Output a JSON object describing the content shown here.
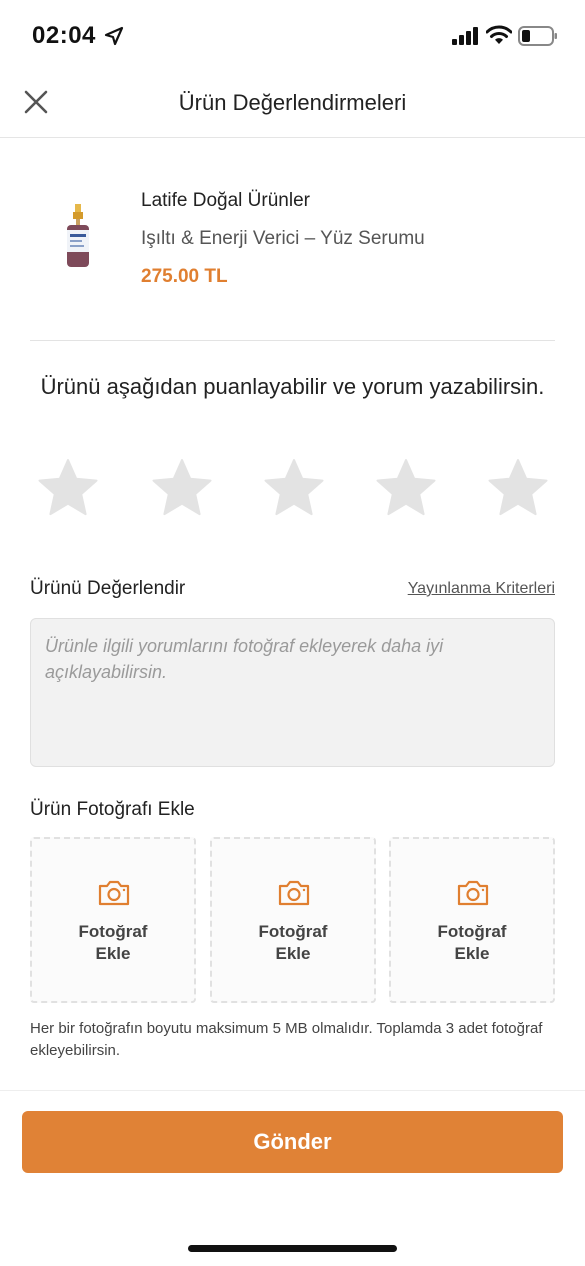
{
  "status_bar": {
    "time": "02:04",
    "icons": [
      "location-arrow-icon",
      "signal-icon",
      "wifi-icon",
      "battery-icon"
    ]
  },
  "header": {
    "title": "Ürün Değerlendirmeleri",
    "close_icon": "close-icon"
  },
  "product": {
    "brand": "Latife Doğal Ürünler",
    "name": "Işıltı & Enerji Verici – Yüz Serumu",
    "price": "275.00 TL",
    "image_icon": "serum-bottle-image"
  },
  "rating": {
    "prompt": "Ürünü aşağıdan puanlayabilir ve yorum yazabilirsin.",
    "max_stars": 5,
    "selected": 0
  },
  "review": {
    "label": "Ürünü Değerlendir",
    "criteria_link": "Yayınlanma Kriterleri",
    "placeholder": "Ürünle ilgili yorumlarını fotoğraf ekleyerek daha iyi açıklayabilirsin.",
    "value": ""
  },
  "photos": {
    "label": "Ürün Fotoğrafı Ekle",
    "slots": [
      {
        "label": "Fotoğraf\nEkle",
        "icon": "camera-icon"
      },
      {
        "label": "Fotoğraf\nEkle",
        "icon": "camera-icon"
      },
      {
        "label": "Fotoğraf\nEkle",
        "icon": "camera-icon"
      }
    ],
    "note": "Her bir fotoğrafın boyutu maksimum 5 MB olmalıdır. Toplamda 3 adet fotoğraf ekleyebilirsin."
  },
  "submit": {
    "label": "Gönder"
  },
  "colors": {
    "accent": "#e08236",
    "price": "#e07f30",
    "star_empty": "#e3e3e3"
  }
}
